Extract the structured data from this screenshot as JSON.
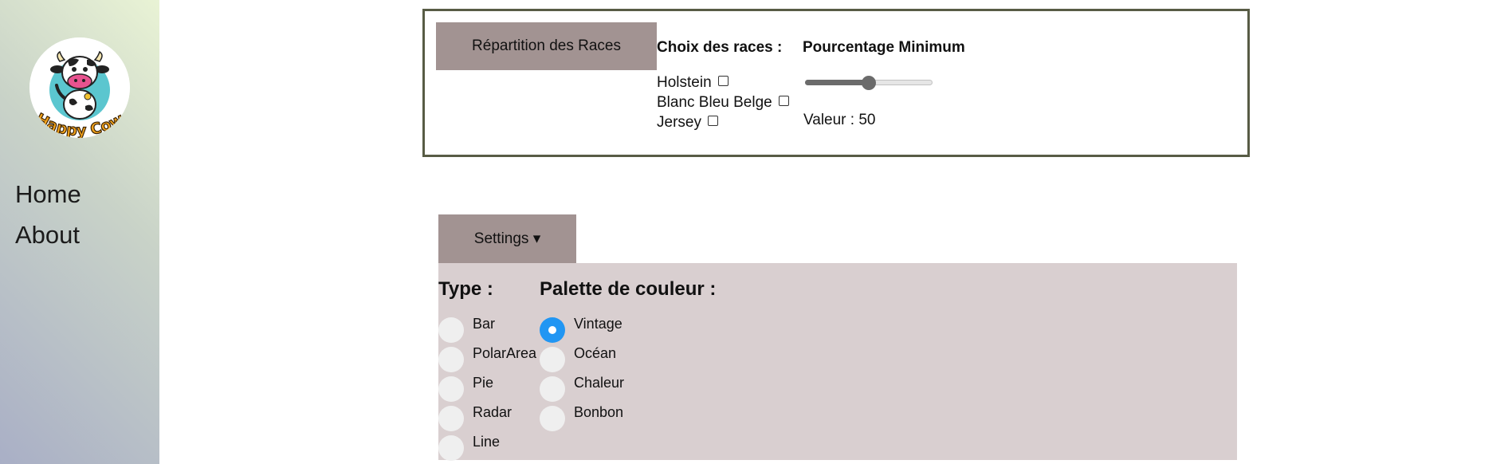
{
  "sidebar": {
    "logo_text": "Happy Cow",
    "nav": [
      {
        "label": "Home"
      },
      {
        "label": "About"
      }
    ]
  },
  "races": {
    "button_label": "Répartition des Races",
    "choice_heading": "Choix des races :",
    "breeds": [
      {
        "label": "Holstein",
        "checked": false
      },
      {
        "label": "Blanc Bleu Belge",
        "checked": false
      },
      {
        "label": "Jersey",
        "checked": false
      }
    ],
    "percentage_heading": "Pourcentage Minimum",
    "slider": {
      "value": 50,
      "min": 0,
      "max": 100
    },
    "value_text": "Valeur : 50"
  },
  "settings": {
    "button_label": "Settings ▾",
    "type_title": "Type :",
    "types": [
      {
        "label": "Bar",
        "checked": false
      },
      {
        "label": "PolarArea",
        "checked": false
      },
      {
        "label": "Pie",
        "checked": false
      },
      {
        "label": "Radar",
        "checked": false
      },
      {
        "label": "Line",
        "checked": false
      }
    ],
    "palette_title": "Palette de couleur :",
    "palettes": [
      {
        "label": "Vintage",
        "checked": true
      },
      {
        "label": "Océan",
        "checked": false
      },
      {
        "label": "Chaleur",
        "checked": false
      },
      {
        "label": "Bonbon",
        "checked": false
      }
    ]
  },
  "colors": {
    "accent": "#2196f3",
    "button_bg": "#a29392",
    "panel_bg": "#d9cfd0",
    "box_border": "#585c45"
  }
}
